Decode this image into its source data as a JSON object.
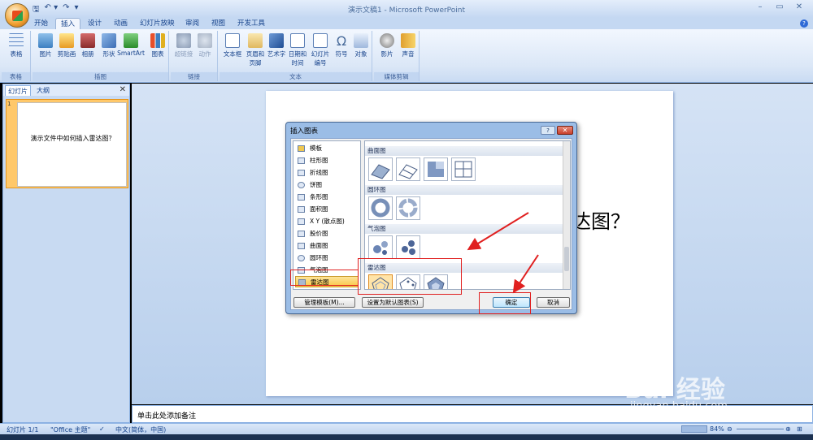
{
  "window": {
    "title": "演示文稿1 - Microsoft PowerPoint",
    "min": "–",
    "max": "▭",
    "close": "✕"
  },
  "qat": {
    "save": "🖫",
    "undo": "↶ ▾",
    "redo": "↷",
    "more": "▾"
  },
  "tabs": [
    "开始",
    "插入",
    "设计",
    "动画",
    "幻灯片放映",
    "审阅",
    "视图",
    "开发工具"
  ],
  "ribbon": {
    "groups": [
      {
        "name": "表格",
        "buttons": [
          "表格"
        ]
      },
      {
        "name": "插图",
        "buttons": [
          "图片",
          "剪贴画",
          "相册",
          "形状",
          "SmartArt",
          "图表"
        ]
      },
      {
        "name": "链接",
        "buttons": [
          "超链接",
          "动作"
        ]
      },
      {
        "name": "文本",
        "buttons": [
          "文本框",
          "页眉和页脚",
          "艺术字",
          "日期和时间",
          "幻灯片编号",
          "符号",
          "对象"
        ]
      },
      {
        "name": "媒体剪辑",
        "buttons": [
          "影片",
          "声音"
        ]
      }
    ]
  },
  "left_pane": {
    "tabs": [
      "幻灯片",
      "大纲"
    ],
    "close": "✕",
    "slide_number": "1",
    "thumbnail_text": "演示文件中如何插入雷达图？"
  },
  "slide": {
    "visible_title_fragment": "达图？"
  },
  "notes_placeholder": "单击此处添加备注",
  "status": {
    "slide_info": "幻灯片 1/1",
    "theme": "\"Office 主题\"",
    "language": "中文(简体，中国)",
    "zoom": "84%"
  },
  "dialog": {
    "title": "插入图表",
    "help": "?",
    "close": "✕",
    "categories": [
      "模板",
      "柱形图",
      "折线图",
      "饼图",
      "条形图",
      "面积图",
      "X Y (散点图)",
      "股价图",
      "曲面图",
      "圆环图",
      "气泡图",
      "雷达图"
    ],
    "selected_category": "雷达图",
    "sections": [
      {
        "name": "曲面图",
        "count": 4
      },
      {
        "name": "圆环图",
        "count": 2
      },
      {
        "name": "气泡图",
        "count": 2
      },
      {
        "name": "雷达图",
        "count": 3
      }
    ],
    "buttons": {
      "manage": "管理模板(M)...",
      "set_default": "设置为默认图表(S)",
      "ok": "确定",
      "cancel": "取消"
    }
  },
  "watermark": {
    "logo": "Bai 经验",
    "url": "jingyan.baidu.com"
  },
  "colors": {
    "ribbon_bg": "#dbe7f7",
    "dialog_frame": "#9bbde6",
    "selection": "#f9c646",
    "annotation": "#e02020"
  }
}
